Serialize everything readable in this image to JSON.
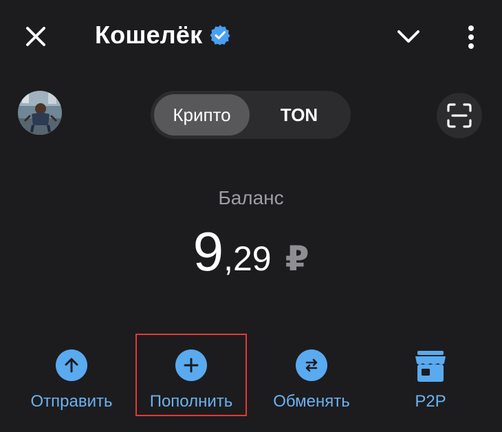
{
  "header": {
    "title": "Кошелёк",
    "close_icon": "close-icon",
    "verified_icon": "verified-badge-icon",
    "chevron_icon": "chevron-down-icon",
    "more_icon": "more-vertical-icon"
  },
  "switcher": {
    "tabs": [
      {
        "label": "Крипто",
        "active": true
      },
      {
        "label": "TON",
        "active": false
      }
    ]
  },
  "scan_icon": "qr-scan-icon",
  "balance": {
    "label": "Баланс",
    "integer": "9",
    "fraction": ",29",
    "currency": "₽"
  },
  "actions": [
    {
      "label": "Отправить",
      "icon": "arrow-up-icon"
    },
    {
      "label": "Пополнить",
      "icon": "plus-icon"
    },
    {
      "label": "Обменять",
      "icon": "swap-arrows-icon"
    },
    {
      "label": "P2P",
      "icon": "store-icon"
    }
  ],
  "colors": {
    "background": "#1c1c1e",
    "accent": "#5aaaf0",
    "accent_text": "#6ab2f2",
    "highlight": "#e53935"
  }
}
